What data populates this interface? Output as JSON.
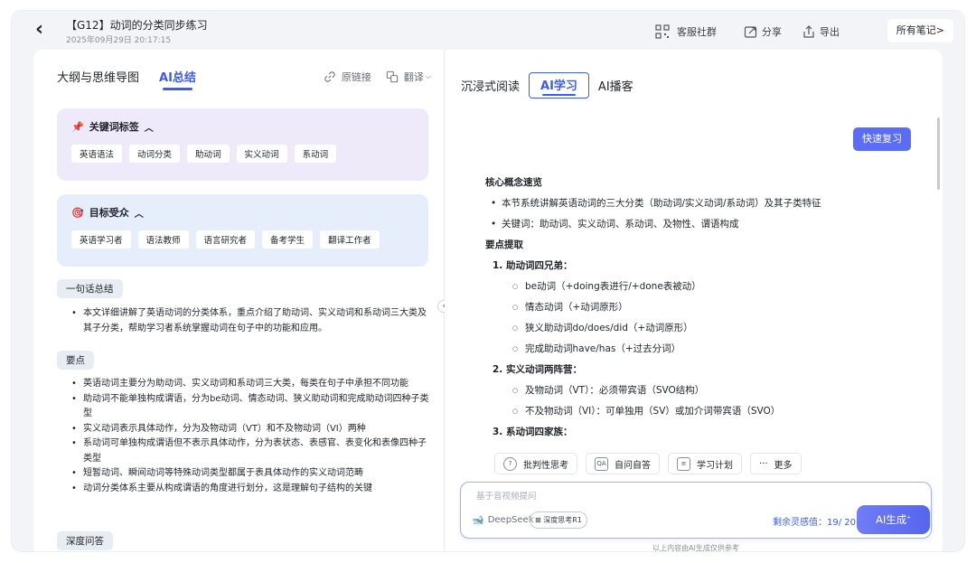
{
  "header": {
    "title": "【G12】动词的分类同步练习",
    "subtitle": "2025年09月29日 20:17:15",
    "community": "客服社群",
    "share": "分享",
    "export": "导出",
    "all_notes": "所有笔记>"
  },
  "left": {
    "tab_outline": "大纲与思维导图",
    "tab_summary": "AI总结",
    "original_link": "原链接",
    "translate": "翻译",
    "keywords_title": "关键词标签",
    "keywords": [
      "英语语法",
      "动词分类",
      "助动词",
      "实义动词",
      "系动词"
    ],
    "audience_title": "目标受众",
    "audience": [
      "英语学习者",
      "语法教师",
      "语言研究者",
      "备考学生",
      "翻译工作者"
    ],
    "one_line_title": "一句话总结",
    "one_line": "本文详细讲解了英语动词的分类体系，重点介绍了助动词、实义动词和系动词三大类及其子分类，帮助学习者系统掌握动词在句子中的功能和应用。",
    "points_title": "要点",
    "points": [
      "英语动词主要分为助动词、实义动词和系动词三大类，每类在句子中承担不同功能",
      "助动词不能单独构成谓语，分为be动词、情态动词、狭义助动词和完成助动词四种子类型",
      "实义动词表示具体动作，分为及物动词（VT）和不及物动词（VI）两种",
      "系动词可单独构成谓语但不表示具体动作，分为表状态、表感官、表变化和表像四种子类型",
      "短暂动词、瞬间动词等特殊动词类型都属于表具体动作的实义动词范畴",
      "动词分类体系主要从构成谓语的角度进行划分，这是理解句子结构的关键"
    ],
    "deep_qa_title": "深度问答"
  },
  "right": {
    "tab_immersive": "沉浸式阅读",
    "tab_ai_learn": "AI学习",
    "tab_podcast": "AI播客",
    "quick_review": "快速复习",
    "core_title": "核心概念速览",
    "core_items": [
      "本节系统讲解英语动词的三大分类（助动词/实义动词/系动词）及其子类特征",
      "关键词：助动词、实义动词、系动词、及物性、谓语构成"
    ],
    "key_title": "要点提取",
    "g1_title": "1. 助动词四兄弟：",
    "g1_items": [
      "be动词（+doing表进行/+done表被动）",
      "情态动词（+动词原形）",
      "狭义助动词do/does/did（+动词原形）",
      "完成助动词have/has（+过去分词）"
    ],
    "g2_title": "2. 实义动词两阵营：",
    "g2_items": [
      "及物动词（VT）：必须带宾语（SVO结构）",
      "不及物动词（VI）：可单独用（SV）或加介词带宾语（SVO）"
    ],
    "g3_title": "3. 系动词四家族：",
    "actions": [
      "批判性思考",
      "自问自答",
      "学习计划",
      "更多"
    ],
    "input_placeholder": "基于音视频提问",
    "model": "DeepSeek",
    "deep_think": "深度思考R1",
    "quota": "剩余灵感值：19/ 20",
    "generate": "AI生成",
    "disclaimer": "以上内容由AI生成仅供参考"
  },
  "colors": {
    "accent": "#3c5cf0",
    "purple_card": "#efeafa",
    "blue_card": "#e6edfb"
  }
}
